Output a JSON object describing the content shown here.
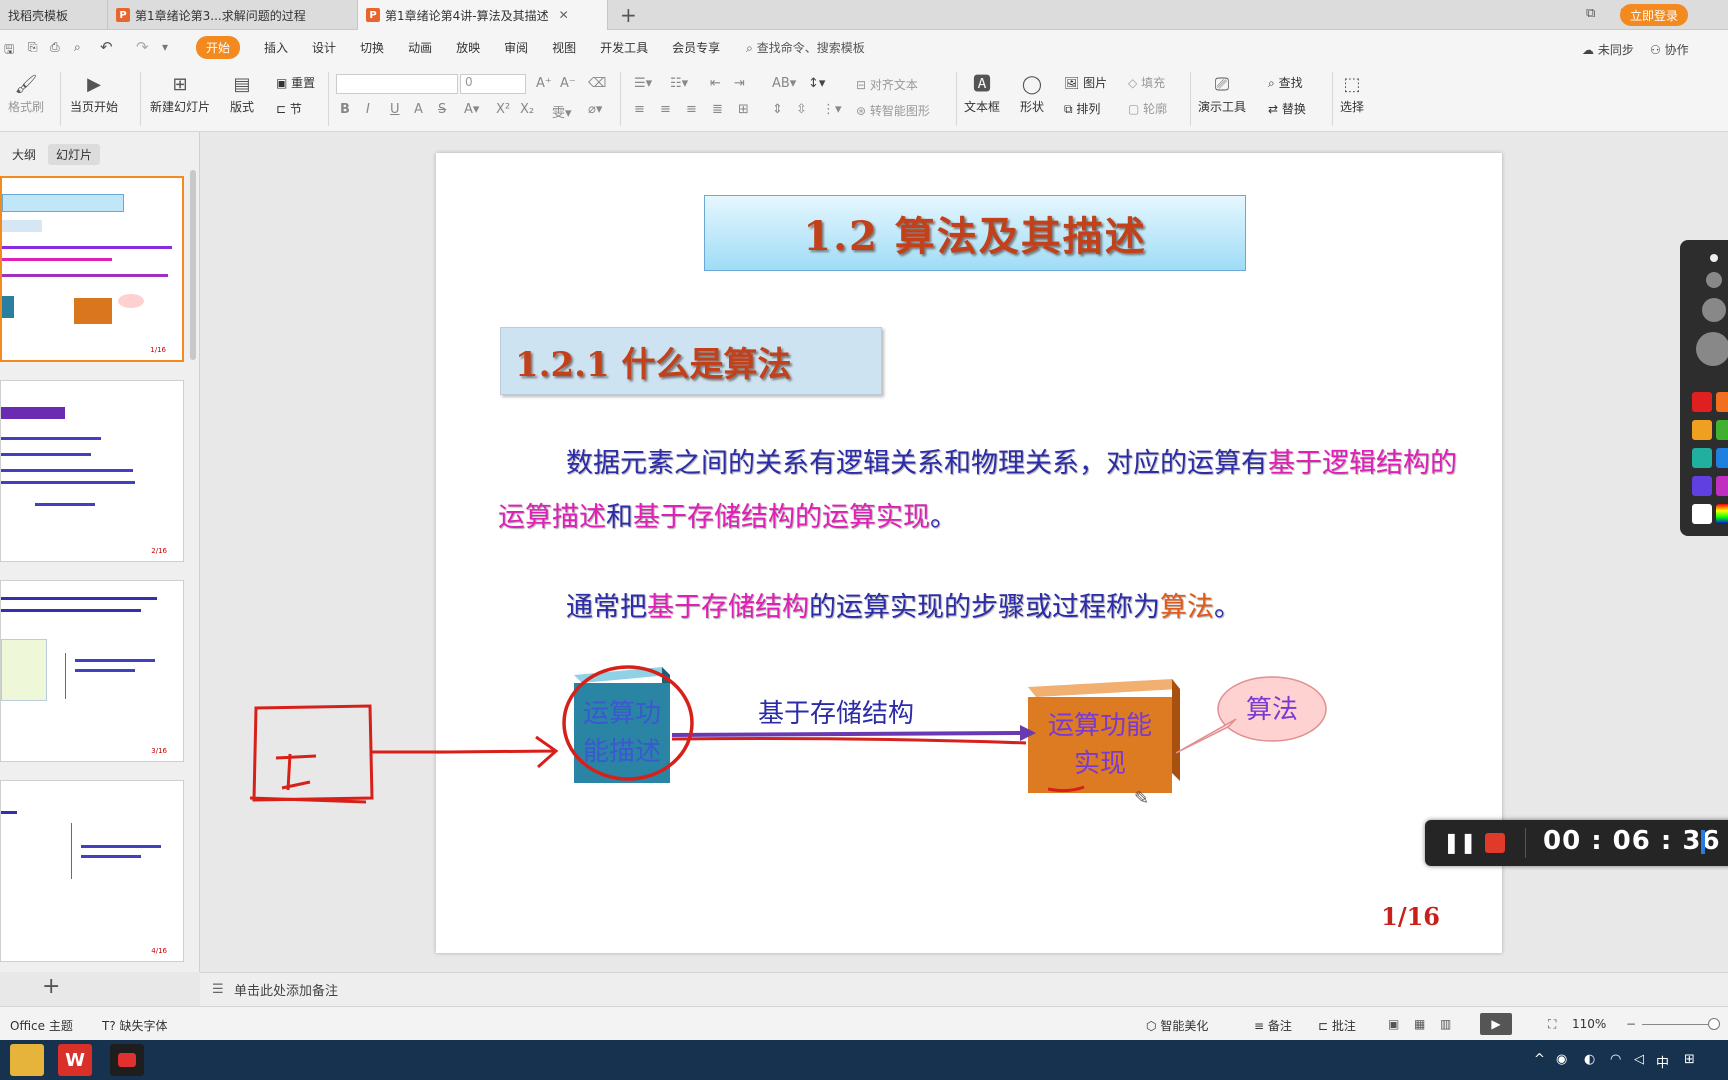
{
  "tabs": [
    {
      "label": "找稻壳模板"
    },
    {
      "label": "第1章绪论第3...求解问题的过程"
    },
    {
      "label": "第1章绪论第4讲-算法及其描述"
    }
  ],
  "login_label": "立即登录",
  "menu": {
    "items": [
      "开始",
      "插入",
      "设计",
      "切换",
      "动画",
      "放映",
      "审阅",
      "视图",
      "开发工具",
      "会员专享"
    ],
    "search_placeholder": "查找命令、搜索模板",
    "sync": "未同步",
    "collab": "协作"
  },
  "ribbon": {
    "format_painter": "格式刷",
    "play_from_current": "当页开始",
    "new_slide": "新建幻灯片",
    "layout": "版式",
    "reset": "重置",
    "section": "节",
    "font_size": "0",
    "align_text": "对齐文本",
    "smart_graphic": "转智能图形",
    "textbox": "文本框",
    "shape": "形状",
    "picture": "图片",
    "arrange": "排列",
    "fill": "填充",
    "outline": "轮廓",
    "presentation_tools": "演示工具",
    "find": "查找",
    "replace": "替换",
    "select": "选择"
  },
  "panel": {
    "outline_tab": "大纲",
    "slides_tab": "幻灯片",
    "thumbs": [
      {
        "num": "1/16"
      },
      {
        "num": "2/16"
      },
      {
        "num": "3/16"
      },
      {
        "num": "4/16"
      }
    ]
  },
  "slide": {
    "title": "1.2 算法及其描述",
    "subtitle": "1.2.1 什么是算法",
    "para1_a": "数据元素之间的关系有逻辑关系和物理关系，对应的运算有",
    "para1_b": "基于逻辑结构的运算描述",
    "para1_c": "和",
    "para1_d": "基于存储结构的运算实现",
    "para1_e": "。",
    "para2_a": "通常把",
    "para2_b": "基于存储结构",
    "para2_c": "的运算实现的步骤或过程称为",
    "para2_d": "算法",
    "para2_e": "。",
    "box_left": "运算功能描述",
    "arrow_label": "基于存储结构",
    "box_right": "运算功能实现",
    "bubble": "算法",
    "page": "1/16"
  },
  "notes_placeholder": "单击此处添加备注",
  "status": {
    "theme": "Office 主题",
    "missing_font": "缺失字体",
    "beautify": "智能美化",
    "notes": "备注",
    "comments": "批注",
    "zoom": "110%"
  },
  "recorder": {
    "time": "00 : 06 : 36"
  },
  "tray": {
    "ime": "中"
  }
}
